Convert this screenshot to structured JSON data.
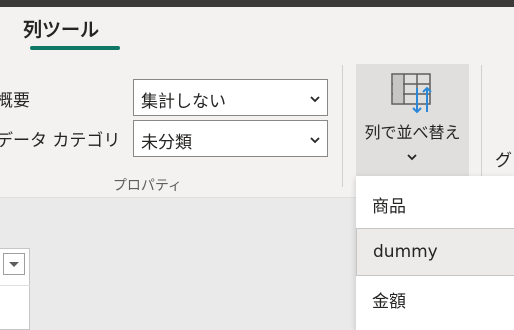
{
  "ribbon_tabs": {
    "active_tab": "列ツール"
  },
  "properties": {
    "summary_label": "概要",
    "summary_value": "集計しない",
    "data_category_label": "データ カテゴリ",
    "data_category_value": "未分類",
    "group_label": "プロパティ"
  },
  "sort": {
    "button_label": "列で並べ替え",
    "next_group_label": "グ"
  },
  "sort_menu": {
    "items": [
      {
        "label": "商品",
        "selected": false
      },
      {
        "label": "dummy",
        "selected": true
      },
      {
        "label": "金額",
        "selected": false
      }
    ]
  },
  "colors": {
    "accent": "#117865",
    "sort_arrow": "#2b88d8",
    "ribbon_bg": "#f3f2f1"
  },
  "icons": {
    "sort_by_column": "sort-by-column-icon",
    "chevron": "chevron-down-icon"
  }
}
